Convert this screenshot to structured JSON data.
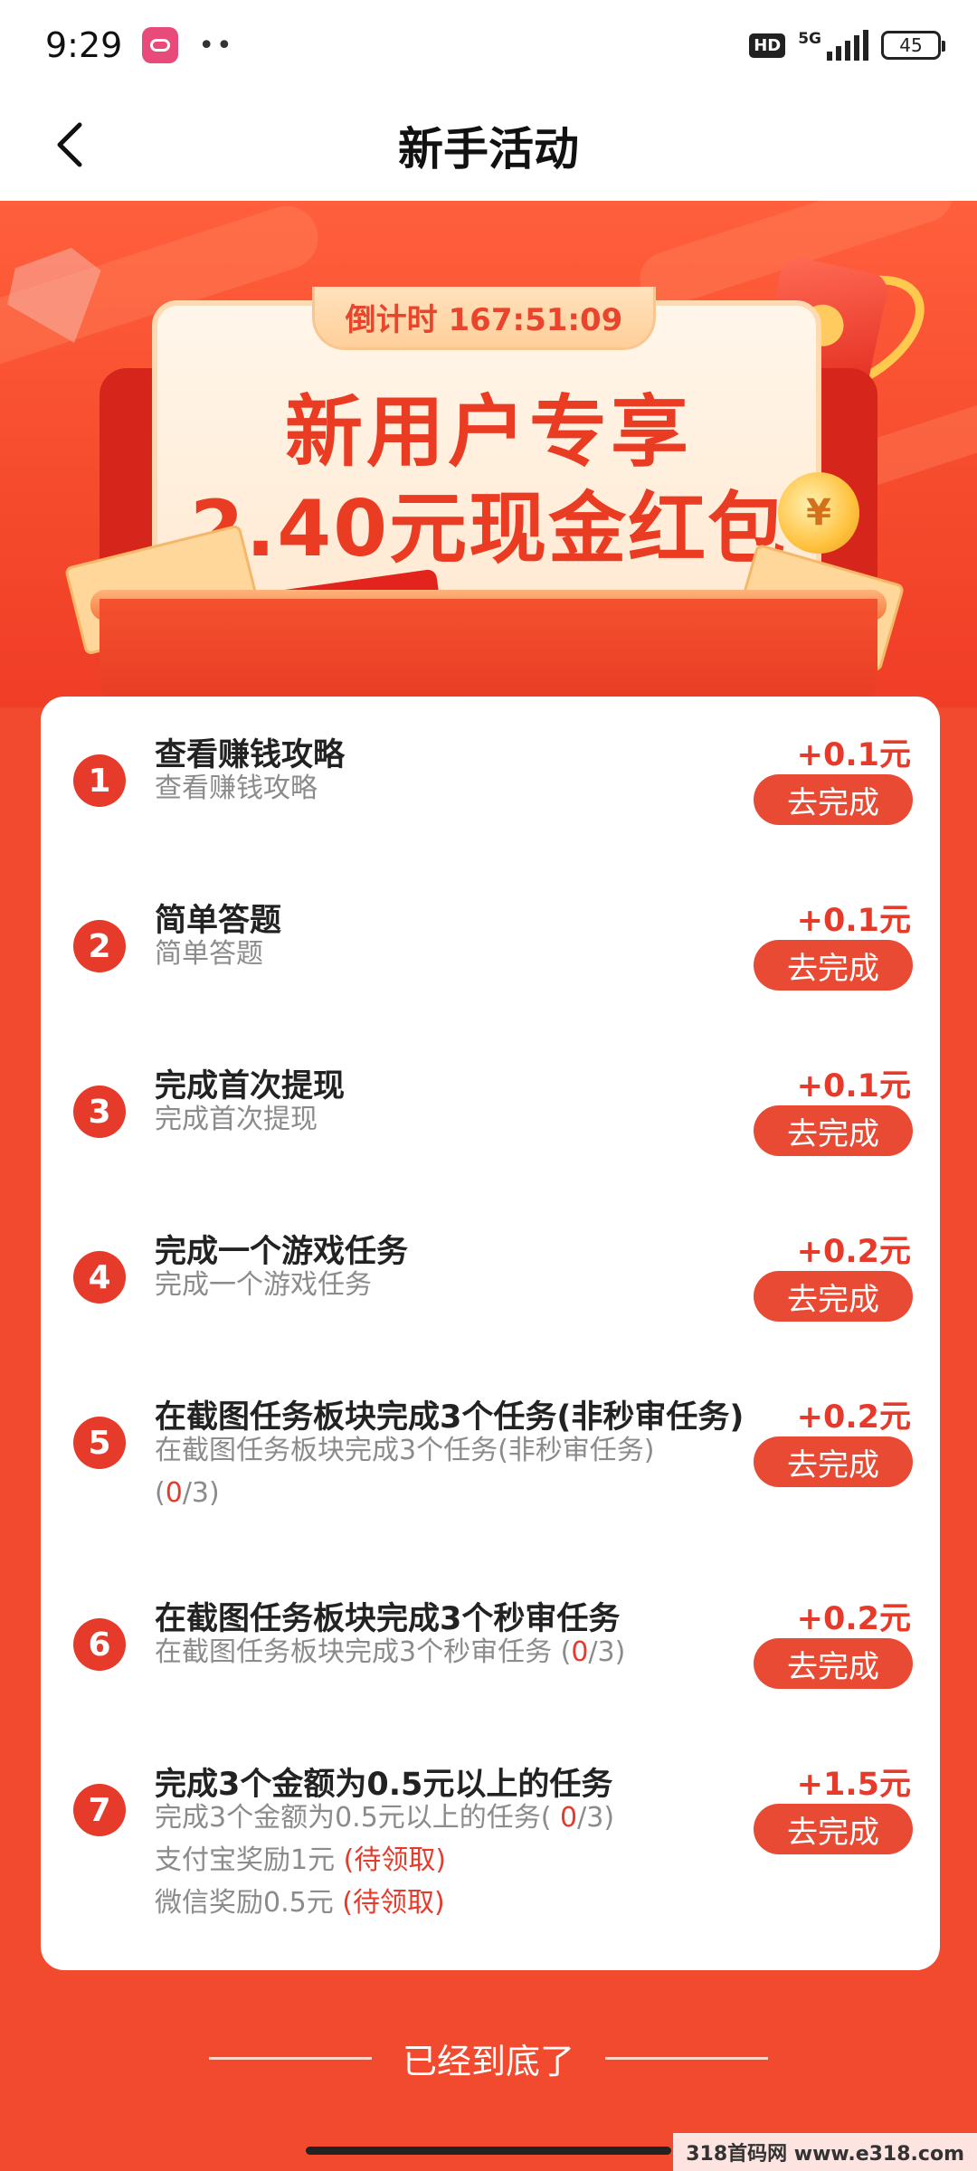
{
  "status_bar": {
    "time": "9:29",
    "more": "••",
    "hd": "HD",
    "network": "5G",
    "battery": "45"
  },
  "header": {
    "title": "新手活动"
  },
  "banner": {
    "countdown": "倒计时 167:51:09",
    "line1": "新用户专享",
    "line2": "2.40元现金红包"
  },
  "tasks": [
    {
      "num": "1",
      "title": "查看赚钱攻略",
      "desc": "查看赚钱攻略",
      "reward": "+0.1元",
      "button": "去完成"
    },
    {
      "num": "2",
      "title": "简单答题",
      "desc": "简单答题",
      "reward": "+0.1元",
      "button": "去完成"
    },
    {
      "num": "3",
      "title": "完成首次提现",
      "desc": "完成首次提现",
      "reward": "+0.1元",
      "button": "去完成"
    },
    {
      "num": "4",
      "title": "完成一个游戏任务",
      "desc": "完成一个游戏任务",
      "reward": "+0.2元",
      "button": "去完成"
    },
    {
      "num": "5",
      "title": "在截图任务板块完成3个任务(非秒审任务)",
      "desc_a": "在截图任务板块完成3个任务(非秒审任务)",
      "progress_open": "(",
      "progress_done": "0",
      "progress_total": "/3)",
      "reward": "+0.2元",
      "button": "去完成"
    },
    {
      "num": "6",
      "title": "在截图任务板块完成3个秒审任务",
      "desc_a": "在截图任务板块完成3个秒审任务 (",
      "progress_done": "0",
      "progress_total": "/3)",
      "reward": "+0.2元",
      "button": "去完成"
    },
    {
      "num": "7",
      "title": "完成3个金额为0.5元以上的任务",
      "desc_a": "完成3个金额为0.5元以上的任务( ",
      "progress_done": "0",
      "progress_total": "/3)",
      "alipay_label": "支付宝奖励1元 ",
      "alipay_status": "(待领取)",
      "wechat_label": "微信奖励0.5元 ",
      "wechat_status": "(待领取)",
      "reward": "+1.5元",
      "button": "去完成"
    }
  ],
  "footer": {
    "end_text": "已经到底了",
    "watermark": "318首码网 www.e318.com"
  },
  "colors": {
    "accent": "#e63a2a",
    "background": "#f14a2e",
    "banner_text": "#ea3b23"
  }
}
